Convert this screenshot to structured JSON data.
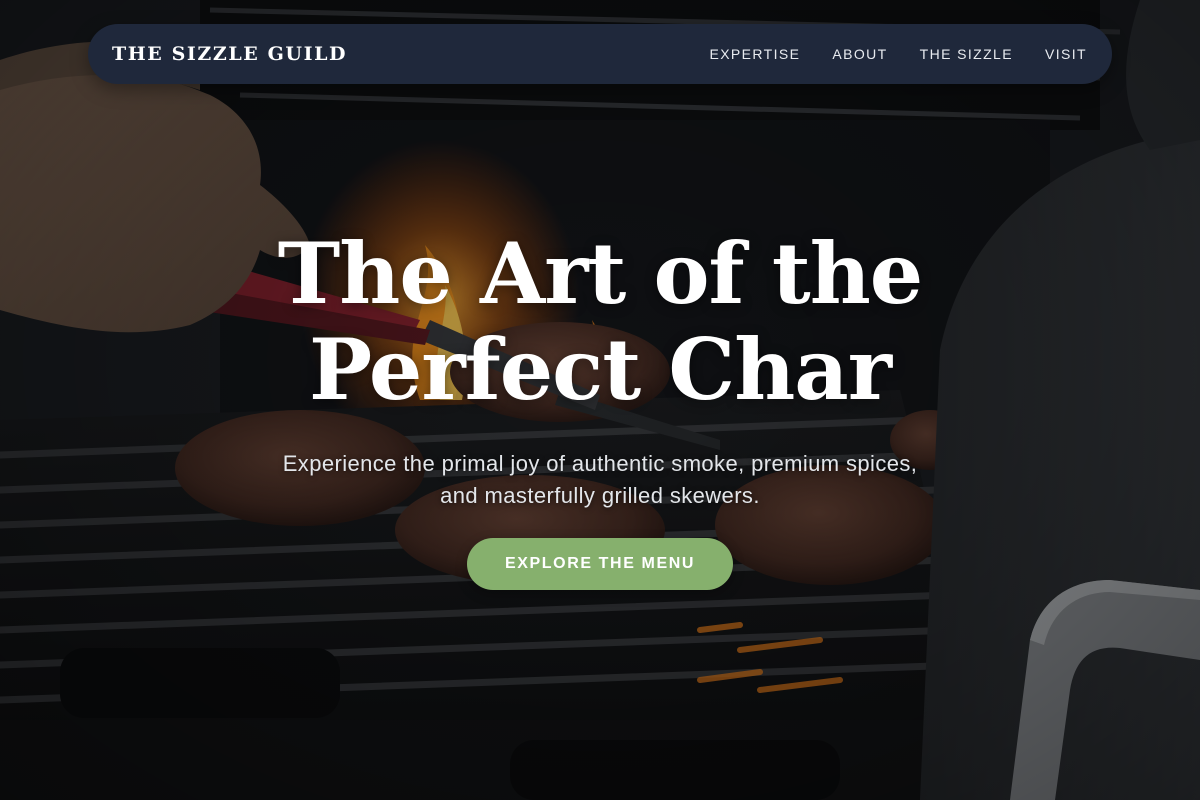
{
  "nav": {
    "brand": "THE SIZZLE GUILD",
    "links": [
      "EXPERTISE",
      "ABOUT",
      "THE SIZZLE",
      "VISIT"
    ]
  },
  "hero": {
    "title_line1": "The Art of the",
    "title_line2": "Perfect Char",
    "subtitle": "Experience the primal joy of authentic smoke, premium spices, and masterfully grilled skewers.",
    "cta_label": "EXPLORE THE MENU",
    "background_image": "grill-with-burgers-and-flames-photo"
  },
  "colors": {
    "nav_background": "#1f283b",
    "cta_background": "#86b06d",
    "text_primary": "#ffffff"
  }
}
